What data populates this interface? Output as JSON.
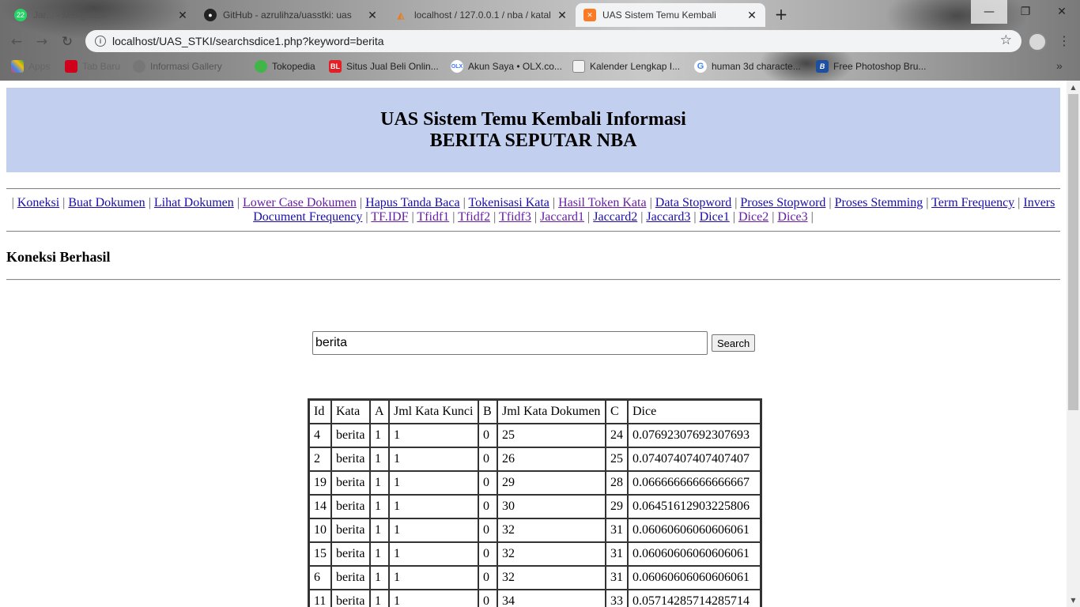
{
  "browser": {
    "tabs": [
      {
        "title": "Jar... - Mengatasi",
        "badge": "22",
        "active": false
      },
      {
        "title": "GitHub - azrulihza/uasstki: uas",
        "active": false
      },
      {
        "title": "localhost / 127.0.0.1 / nba / katal",
        "active": false
      },
      {
        "title": "UAS Sistem Temu Kembali",
        "active": true
      }
    ],
    "new_tab": "+",
    "url": "localhost/UAS_STKI/searchsdice1.php?keyword=berita",
    "bookmarks": [
      {
        "label": "Apps",
        "color": "#e8453c"
      },
      {
        "label": "Tab Baru",
        "color": "#d0021b"
      },
      {
        "label": "Informasi Gallery",
        "color": "#555555"
      },
      {
        "label": "Tokopedia",
        "color": "#42b549"
      },
      {
        "label": "Situs Jual Beli Onlin...",
        "color": "#e31e24"
      },
      {
        "label": "Akun Saya • OLX.co...",
        "color": "#ffffff"
      },
      {
        "label": "Kalender Lengkap I...",
        "color": "#7a7a7a"
      },
      {
        "label": "human 3d characte...",
        "color": "#4285f4"
      },
      {
        "label": "Free Photoshop Bru...",
        "color": "#1f4fa0"
      }
    ],
    "bookmark_icons": [
      "BL",
      "OLX",
      "G",
      "B"
    ]
  },
  "page": {
    "title_line1": "UAS Sistem Temu Kembali Informasi",
    "title_line2": "BERITA SEPUTAR NBA",
    "nav": [
      {
        "label": "Koneksi",
        "visited": false
      },
      {
        "label": "Buat Dokumen",
        "visited": false
      },
      {
        "label": "Lihat Dokumen",
        "visited": false
      },
      {
        "label": "Lower Case Dokumen",
        "visited": true
      },
      {
        "label": "Hapus Tanda Baca",
        "visited": false
      },
      {
        "label": "Tokenisasi Kata",
        "visited": false
      },
      {
        "label": "Hasil Token Kata",
        "visited": true
      },
      {
        "label": "Data Stopword",
        "visited": false
      },
      {
        "label": "Proses Stopword",
        "visited": false
      },
      {
        "label": "Proses Stemming",
        "visited": false
      },
      {
        "label": "Term Frequency",
        "visited": false
      },
      {
        "label": "Invers Document Frequency",
        "visited": false
      },
      {
        "label": "TF.IDF",
        "visited": true
      },
      {
        "label": "Tfidf1",
        "visited": true
      },
      {
        "label": "Tfidf2",
        "visited": true
      },
      {
        "label": "Tfidf3",
        "visited": true
      },
      {
        "label": "Jaccard1",
        "visited": true
      },
      {
        "label": "Jaccard2",
        "visited": false
      },
      {
        "label": "Jaccard3",
        "visited": false
      },
      {
        "label": "Dice1",
        "visited": false
      },
      {
        "label": "Dice2",
        "visited": true
      },
      {
        "label": "Dice3",
        "visited": true
      }
    ],
    "connection_message": "Koneksi Berhasil",
    "search": {
      "value": "berita",
      "button": "Search"
    },
    "table": {
      "headers": [
        "Id",
        "Kata",
        "A",
        "Jml Kata Kunci",
        "B",
        "Jml Kata Dokumen",
        "C",
        "Dice"
      ],
      "rows": [
        [
          "4",
          "berita",
          "1",
          "1",
          "0",
          "25",
          "24",
          "0.07692307692307693"
        ],
        [
          "2",
          "berita",
          "1",
          "1",
          "0",
          "26",
          "25",
          "0.07407407407407407"
        ],
        [
          "19",
          "berita",
          "1",
          "1",
          "0",
          "29",
          "28",
          "0.06666666666666667"
        ],
        [
          "14",
          "berita",
          "1",
          "1",
          "0",
          "30",
          "29",
          "0.06451612903225806"
        ],
        [
          "10",
          "berita",
          "1",
          "1",
          "0",
          "32",
          "31",
          "0.06060606060606061"
        ],
        [
          "15",
          "berita",
          "1",
          "1",
          "0",
          "32",
          "31",
          "0.06060606060606061"
        ],
        [
          "6",
          "berita",
          "1",
          "1",
          "0",
          "32",
          "31",
          "0.06060606060606061"
        ],
        [
          "11",
          "berita",
          "1",
          "1",
          "0",
          "34",
          "33",
          "0.05714285714285714"
        ]
      ]
    }
  }
}
